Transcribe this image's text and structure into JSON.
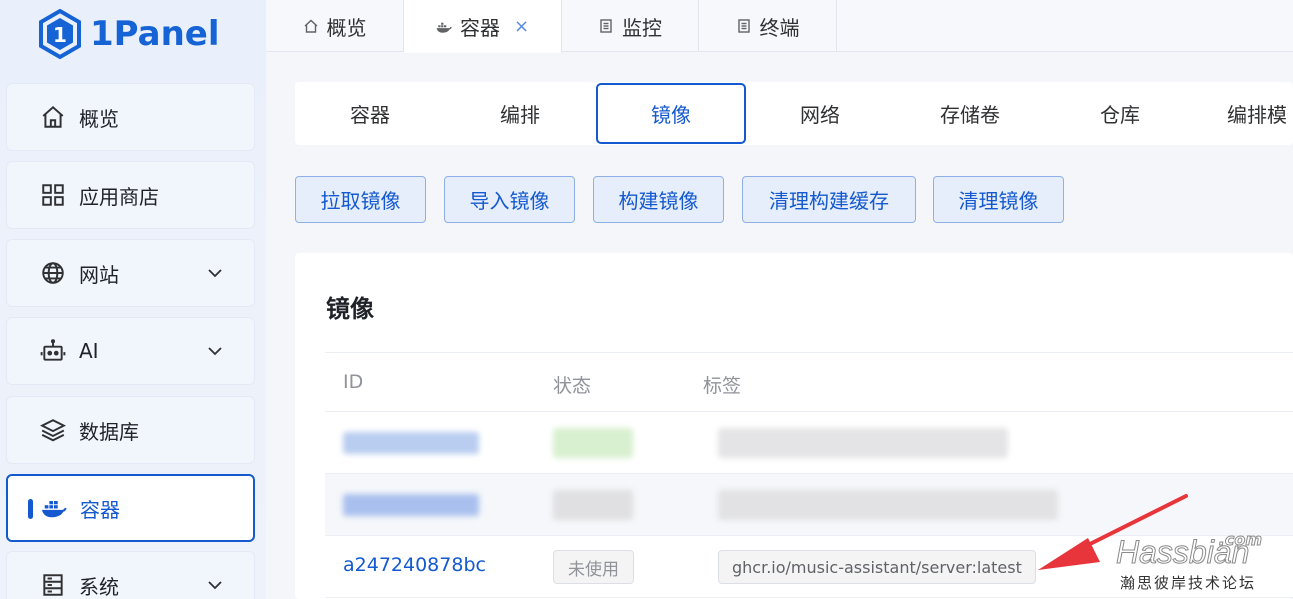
{
  "app": {
    "logo_text": "1Panel"
  },
  "sidebar": {
    "items": [
      {
        "label": "概览",
        "icon": "home-icon"
      },
      {
        "label": "应用商店",
        "icon": "grid-icon"
      },
      {
        "label": "网站",
        "icon": "globe-icon",
        "expandable": true
      },
      {
        "label": "AI",
        "icon": "robot-icon",
        "expandable": true
      },
      {
        "label": "数据库",
        "icon": "layers-icon"
      },
      {
        "label": "容器",
        "icon": "docker-icon",
        "active": true
      },
      {
        "label": "系统",
        "icon": "server-icon",
        "expandable": true
      }
    ]
  },
  "top_tabs": [
    {
      "label": "概览",
      "icon": "home-icon"
    },
    {
      "label": "容器",
      "icon": "docker-icon",
      "active": true,
      "close": "×"
    },
    {
      "label": "监控",
      "icon": "doc-icon"
    },
    {
      "label": "终端",
      "icon": "doc-icon"
    }
  ],
  "sub_tabs": [
    {
      "label": "容器"
    },
    {
      "label": "编排"
    },
    {
      "label": "镜像",
      "active": true
    },
    {
      "label": "网络"
    },
    {
      "label": "存储卷"
    },
    {
      "label": "仓库"
    },
    {
      "label": "编排模"
    }
  ],
  "actions": {
    "pull": "拉取镜像",
    "import": "导入镜像",
    "build": "构建镜像",
    "clean_cache": "清理构建缓存",
    "clean_images": "清理镜像"
  },
  "card": {
    "title": "镜像",
    "columns": {
      "id": "ID",
      "status": "状态",
      "tags": "标签"
    },
    "rows": [
      {
        "id": "",
        "status": "",
        "tag": "",
        "redacted": true
      },
      {
        "id": "",
        "status": "",
        "tag": "",
        "redacted": true
      },
      {
        "id": "a247240878bc",
        "status": "未使用",
        "tag": "ghcr.io/music-assistant/server:latest"
      }
    ]
  },
  "watermark": {
    "com": ".com",
    "main": "Hassbian",
    "sub": "瀚思彼岸技术论坛"
  },
  "colors": {
    "accent": "#1459cf",
    "arrow": "#e8353b"
  }
}
